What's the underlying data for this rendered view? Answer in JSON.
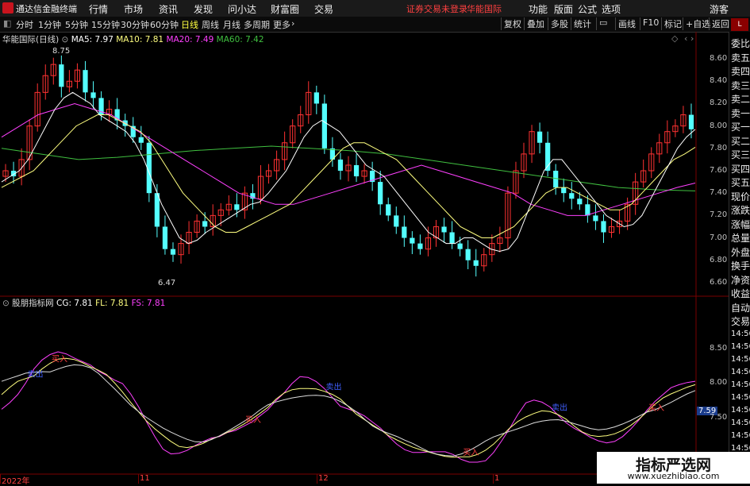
{
  "app": {
    "name": "通达信金融终端"
  },
  "menu": [
    "行情",
    "市场",
    "资讯",
    "发现",
    "问小达",
    "财富圈",
    "交易"
  ],
  "notice": {
    "login": "证券交易未登录",
    "stock": "华能国际"
  },
  "menu_right": [
    "功能",
    "版面",
    "公式",
    "选项"
  ],
  "guest": "游客",
  "periods": [
    "分时",
    "1分钟",
    "5分钟",
    "15分钟",
    "30分钟",
    "60分钟",
    "日线",
    "周线",
    "月线",
    "多周期",
    "更多"
  ],
  "active_period": "日线",
  "tools_right": [
    "复权",
    "叠加",
    "多股",
    "统计",
    "画线",
    "F10",
    "标记",
    "+自选",
    "返回"
  ],
  "main_legend": {
    "title": "华能国际(日线)",
    "ma5": "MA5: 7.97",
    "ma10": "MA10: 7.81",
    "ma20": "MA20: 7.49",
    "ma60": "MA60: 7.42"
  },
  "sub_legend": {
    "title": "股朋指标网",
    "cg": "CG: 7.81",
    "fl": "FL: 7.81",
    "fs": "FS: 7.81"
  },
  "colors": {
    "up": "#ff3232",
    "down": "#54ffff",
    "ma5": "#ffffff",
    "ma10": "#ffff80",
    "ma20": "#ff40ff",
    "ma60": "#40c040",
    "fs": "#ff40ff",
    "fl": "#ffff80",
    "cg": "#ffffff"
  },
  "right_panel": [
    "委比",
    "卖五",
    "卖四",
    "卖三",
    "卖二",
    "卖一",
    "买一",
    "买二",
    "买三",
    "买四",
    "买五",
    "现价",
    "涨跌",
    "涨幅",
    "总量",
    "外盘",
    "换手",
    "净资",
    "收益",
    "自动",
    "交易"
  ],
  "right_times": [
    "14:56",
    "14:56",
    "14:56",
    "14:56",
    "14:56",
    "14:56",
    "14:56",
    "14:56",
    "14:56",
    "14:56",
    "14:56",
    "14:56"
  ],
  "price_axis": [
    "8.60",
    "8.40",
    "8.20",
    "8.00",
    "7.80",
    "7.60",
    "7.40",
    "7.20",
    "7.00",
    "6.80",
    "6.60"
  ],
  "sub_axis": [
    "8.50",
    "8.00",
    "7.59",
    "7.50"
  ],
  "date_axis": [
    "2022年",
    "11",
    "12",
    "1"
  ],
  "annotations": {
    "high": "8.75",
    "low": "6.47"
  },
  "signals": {
    "buy": "买入",
    "sell": "卖出"
  },
  "watermark": {
    "title": "指标严选网",
    "url": "www.xuezhibiao.com"
  },
  "chart_data": {
    "type": "candlestick",
    "title": "华能国际(日线)",
    "ylim": [
      6.5,
      8.7
    ],
    "ohlc_summary": {
      "high": 8.75,
      "low": 6.47,
      "last_ma5": 7.97,
      "last_ma10": 7.81,
      "last_ma20": 7.49,
      "last_ma60": 7.42
    },
    "closes": [
      7.6,
      7.55,
      7.7,
      8.0,
      8.3,
      8.45,
      8.55,
      8.35,
      8.4,
      8.5,
      8.3,
      8.25,
      8.1,
      8.15,
      8.05,
      8.0,
      7.9,
      7.85,
      7.4,
      7.1,
      6.9,
      6.85,
      6.95,
      7.05,
      7.15,
      7.1,
      7.2,
      7.25,
      7.3,
      7.25,
      7.4,
      7.35,
      7.55,
      7.6,
      7.7,
      7.85,
      8.0,
      8.1,
      8.3,
      8.2,
      7.8,
      7.7,
      7.6,
      7.65,
      7.55,
      7.6,
      7.5,
      7.3,
      7.2,
      7.1,
      7.0,
      6.95,
      6.9,
      7.0,
      7.1,
      7.05,
      6.95,
      6.9,
      6.8,
      6.75,
      6.85,
      6.95,
      7.0,
      7.4,
      7.6,
      7.75,
      7.95,
      7.85,
      7.6,
      7.45,
      7.4,
      7.35,
      7.3,
      7.2,
      7.15,
      7.05,
      7.1,
      7.15,
      7.3,
      7.5,
      7.6,
      7.75,
      7.85,
      7.95,
      8.0,
      8.1,
      7.97
    ],
    "ma5": [
      7.5,
      7.55,
      7.6,
      7.7,
      7.85,
      8.0,
      8.15,
      8.25,
      8.3,
      8.25,
      8.2,
      8.1,
      8.05,
      8.0,
      7.95,
      7.85,
      7.7,
      7.5,
      7.3,
      7.15,
      7.0,
      6.95,
      6.98,
      7.05,
      7.1,
      7.15,
      7.2,
      7.25,
      7.3,
      7.32,
      7.4,
      7.5,
      7.6,
      7.75,
      7.9,
      8.0,
      8.05,
      8.0,
      7.95,
      7.85,
      7.75,
      7.65,
      7.6,
      7.55,
      7.45,
      7.35,
      7.25,
      7.15,
      7.05,
      7.0,
      6.95,
      6.95,
      7.0,
      7.0,
      6.95,
      6.9,
      6.88,
      6.9,
      7.0,
      7.2,
      7.4,
      7.6,
      7.7,
      7.7,
      7.6,
      7.5,
      7.4,
      7.3,
      7.2,
      7.15,
      7.1,
      7.12,
      7.2,
      7.35,
      7.5,
      7.65,
      7.8,
      7.9,
      7.97
    ],
    "ma10": [
      7.45,
      7.5,
      7.55,
      7.6,
      7.7,
      7.8,
      7.9,
      8.0,
      8.05,
      8.1,
      8.1,
      8.05,
      8.0,
      7.95,
      7.85,
      7.7,
      7.55,
      7.4,
      7.3,
      7.2,
      7.1,
      7.05,
      7.05,
      7.1,
      7.15,
      7.2,
      7.25,
      7.3,
      7.4,
      7.5,
      7.6,
      7.7,
      7.8,
      7.85,
      7.85,
      7.8,
      7.75,
      7.7,
      7.6,
      7.5,
      7.4,
      7.3,
      7.2,
      7.1,
      7.05,
      7.0,
      7.0,
      7.05,
      7.1,
      7.2,
      7.3,
      7.4,
      7.45,
      7.45,
      7.4,
      7.35,
      7.3,
      7.25,
      7.25,
      7.3,
      7.4,
      7.5,
      7.6,
      7.7,
      7.75,
      7.81
    ],
    "ma20": [
      7.9,
      8.0,
      8.1,
      8.15,
      8.2,
      8.15,
      8.1,
      8.0,
      7.9,
      7.8,
      7.7,
      7.6,
      7.5,
      7.4,
      7.35,
      7.3,
      7.3,
      7.35,
      7.4,
      7.45,
      7.5,
      7.55,
      7.6,
      7.65,
      7.6,
      7.55,
      7.5,
      7.45,
      7.4,
      7.3,
      7.25,
      7.2,
      7.2,
      7.25,
      7.3,
      7.35,
      7.4,
      7.45,
      7.49
    ],
    "ma60": [
      7.8,
      7.75,
      7.7,
      7.72,
      7.75,
      7.78,
      7.8,
      7.82,
      7.8,
      7.78,
      7.75,
      7.7,
      7.65,
      7.6,
      7.55,
      7.5,
      7.45,
      7.43,
      7.42
    ]
  }
}
